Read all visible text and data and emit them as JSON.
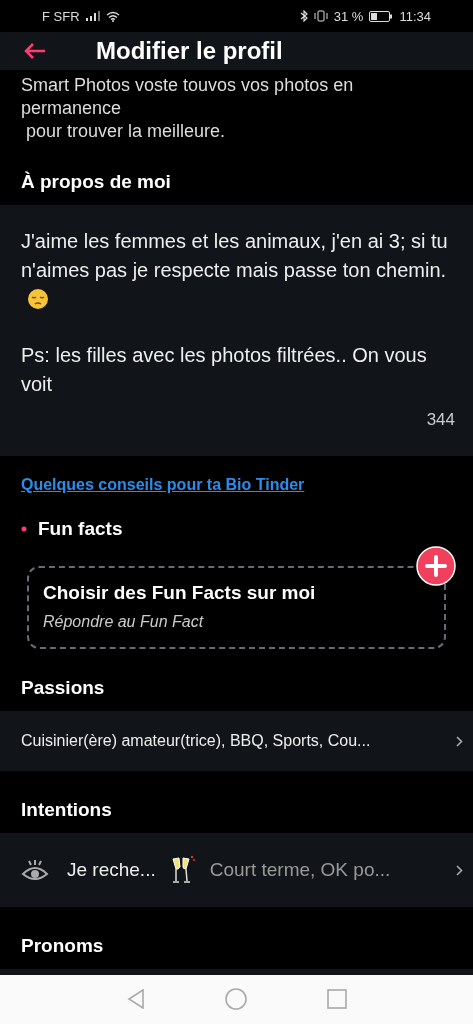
{
  "status_bar": {
    "carrier": "F SFR",
    "battery": "31 %",
    "time": "11:34"
  },
  "header": {
    "title": "Modifier le profil"
  },
  "smart_photos": {
    "text": "Smart Photos voste touvos vos photos en permanence",
    "text_2": " pour trouver la meilleure."
  },
  "about": {
    "heading": "À propos de moi",
    "paragraphs": [
      "J'aime les femmes et les animaux, j'en ai 3; si tu n'aimes pas je respecte mais passe ton chemin.",
      "Ps: les filles avec les photos filtrées.. On vous voit"
    ],
    "counter": "344"
  },
  "tips_link": "Quelques conseils pour ta Bio Tinder",
  "fun_facts": {
    "heading": "Fun facts",
    "card_title": "Choisir des Fun Facts sur moi",
    "card_subtitle": "Répondre au Fun Fact"
  },
  "passions": {
    "heading": "Passions",
    "value": "Cuisinier(ère) amateur(trice), BBQ, Sports, Cou..."
  },
  "intentions": {
    "heading": "Intentions",
    "label": "Je reche...",
    "value": "Court terme, OK po..."
  },
  "pronouns": {
    "heading": "Pronoms"
  }
}
